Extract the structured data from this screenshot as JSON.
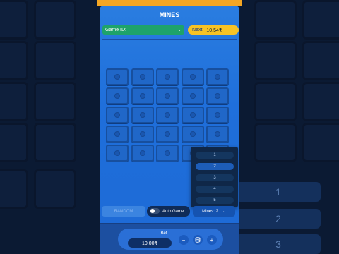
{
  "game": {
    "title": "MINES",
    "game_id_label": "Game ID:",
    "next_label": "Next:",
    "next_value": "10.54₹"
  },
  "dropdown": {
    "options": [
      "1",
      "2",
      "3",
      "4",
      "5"
    ],
    "selected": "2"
  },
  "controls": {
    "random_label": "RANDOM",
    "auto_game_label": "Auto Game",
    "auto_game_enabled": false,
    "mines_label": "Mines: 2"
  },
  "bet": {
    "label": "Bet",
    "value": "10.00₹",
    "minus": "−",
    "plus": "+"
  },
  "background": {
    "side_numbers": [
      "1",
      "2",
      "3"
    ]
  },
  "colors": {
    "accent": "#f7c325",
    "primary": "#1f6fdb",
    "success": "#36c04f"
  },
  "icons": {
    "coins": "coins-icon",
    "toggle": "toggle-icon",
    "chevron": "chevron-down-icon"
  }
}
